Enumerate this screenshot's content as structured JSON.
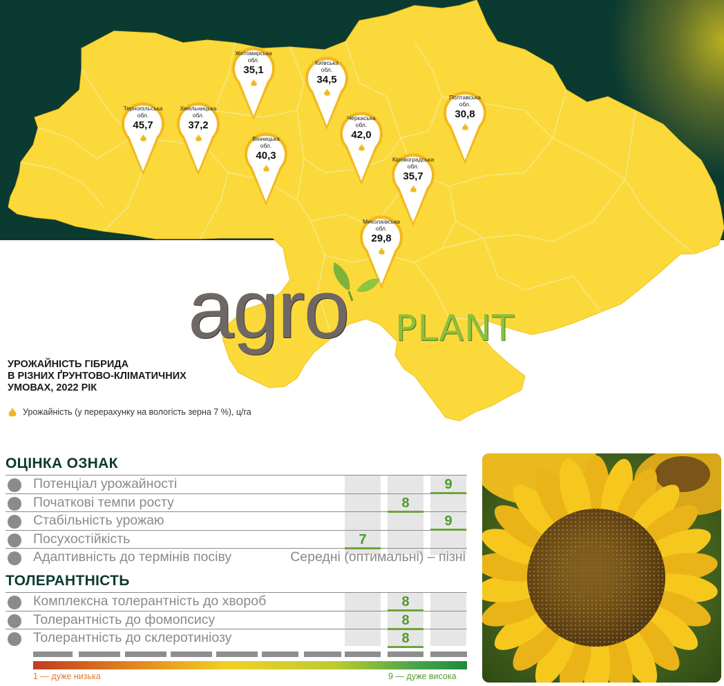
{
  "caption": {
    "line1": "УРОЖАЙНІСТЬ ГІБРИДА",
    "line2": "В РІЗНИХ ҐРУНТОВО-КЛІМАТИЧНИХ",
    "line3": "УМОВАХ, 2022 РІК",
    "legend": "Урожайність (у перерахунку на вологість зерна 7 %), ц/га"
  },
  "logo": {
    "word1": "agro",
    "word2": "PLANT"
  },
  "regions": [
    {
      "name1": "Тернопільська",
      "name2": "обл.",
      "value": "45,7"
    },
    {
      "name1": "Хмельницька",
      "name2": "обл.",
      "value": "37,2"
    },
    {
      "name1": "Житомирська",
      "name2": "обл.",
      "value": "35,1"
    },
    {
      "name1": "Вінницька",
      "name2": "обл.",
      "value": "40,3"
    },
    {
      "name1": "Київська",
      "name2": "обл.",
      "value": "34,5"
    },
    {
      "name1": "Черкаська",
      "name2": "обл.",
      "value": "42,0"
    },
    {
      "name1": "Полтавська",
      "name2": "обл.",
      "value": "30,8"
    },
    {
      "name1": "Кіровоградська",
      "name2": "обл.",
      "value": "35,7"
    },
    {
      "name1": "Миколаївська",
      "name2": "обл.",
      "value": "29,8"
    }
  ],
  "traits_title": "ОЦІНКА ОЗНАК",
  "traits": [
    {
      "label": "Потенціал урожайності",
      "score": "9",
      "level": 9,
      "icon": "yield-potential-icon"
    },
    {
      "label": "Початкові темпи росту",
      "score": "8",
      "level": 8,
      "icon": "early-growth-icon"
    },
    {
      "label": "Стабільність урожаю",
      "score": "9",
      "level": 9,
      "icon": "yield-stability-icon"
    },
    {
      "label": "Посухостійкість",
      "score": "7",
      "level": 7,
      "icon": "drought-tolerance-icon"
    },
    {
      "label": "Адаптивність до термінів посіву",
      "text": "Середні (оптимальні) – пізні",
      "icon": "sowing-adaptivity-icon"
    }
  ],
  "tolerance_title": "ТОЛЕРАНТНІСТЬ",
  "tolerance": [
    {
      "label": "Комплексна толерантність до хвороб",
      "score": "8",
      "level": 8,
      "icon": "disease-tolerance-icon"
    },
    {
      "label": "Толерантність до фомопсису",
      "score": "8",
      "level": 8,
      "icon": "phomopsis-tolerance-icon"
    },
    {
      "label": "Толерантність до склеротиніозу",
      "score": "8",
      "level": 8,
      "icon": "sclerotinia-tolerance-icon"
    }
  ],
  "scale": {
    "low": "1 — дуже низька",
    "high": "9 — дуже висока"
  },
  "colors": {
    "map": "#fbd93a",
    "dark": "#0b3a30",
    "score": "#4f9a2d",
    "accent": "#8dbf3e"
  }
}
